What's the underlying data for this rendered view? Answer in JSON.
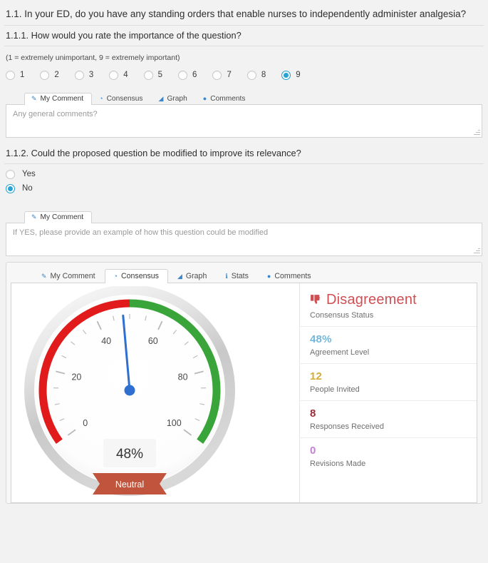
{
  "question": {
    "number": "1.1.",
    "text": "1.1. In your ED, do you have any standing orders that enable nurses to independently administer analgesia?"
  },
  "sub1": {
    "text": "1.1.1. How would you rate the importance of the question?",
    "hint": "(1 = extremely unimportant, 9 = extremely important)",
    "options": [
      "1",
      "2",
      "3",
      "4",
      "5",
      "6",
      "7",
      "8",
      "9"
    ],
    "selected": "9"
  },
  "sub2": {
    "text": "1.1.2. Could the proposed question be modified to improve its relevance?",
    "options": [
      "Yes",
      "No"
    ],
    "selected": "No"
  },
  "tabs_top": [
    {
      "label": "My Comment",
      "icon": "pencil-icon",
      "glyph": "✎",
      "active": true
    },
    {
      "label": "Consensus",
      "icon": "gauge-icon",
      "glyph": "◔",
      "active": false
    },
    {
      "label": "Graph",
      "icon": "bar-chart-icon",
      "glyph": "◢",
      "active": false
    },
    {
      "label": "Comments",
      "icon": "comment-icon",
      "glyph": "●",
      "active": false
    }
  ],
  "tabs_mid": [
    {
      "label": "My Comment",
      "icon": "pencil-icon",
      "glyph": "✎",
      "active": true
    }
  ],
  "tabs_bottom": [
    {
      "label": "My Comment",
      "icon": "pencil-icon",
      "glyph": "✎",
      "active": false
    },
    {
      "label": "Consensus",
      "icon": "gauge-icon",
      "glyph": "◔",
      "active": true
    },
    {
      "label": "Graph",
      "icon": "bar-chart-icon",
      "glyph": "◢",
      "active": false
    },
    {
      "label": "Stats",
      "icon": "info-icon",
      "glyph": "ℹ",
      "active": false
    },
    {
      "label": "Comments",
      "icon": "comment-icon",
      "glyph": "●",
      "active": false
    }
  ],
  "comment_top": {
    "placeholder": "Any general comments?",
    "value": ""
  },
  "comment_mid": {
    "placeholder": "If YES, please provide an example of how this question could be modified",
    "value": ""
  },
  "stats": [
    {
      "name": "consensus-status",
      "value": "Disagreement",
      "label": "Consensus Status",
      "color": "#cf4f55",
      "icon": "thumbs-down-icon"
    },
    {
      "name": "agreement-level",
      "value": "48%",
      "label": "Agreement Level",
      "color": "#74b7d8"
    },
    {
      "name": "people-invited",
      "value": "12",
      "label": "People Invited",
      "color": "#d3ac3c"
    },
    {
      "name": "responses-received",
      "value": "8",
      "label": "Responses Received",
      "color": "#9e2b36"
    },
    {
      "name": "revisions-made",
      "value": "0",
      "label": "Revisions Made",
      "color": "#c77fd6"
    }
  ],
  "chart_data": {
    "type": "gauge",
    "title": "Consensus Gauge",
    "value": 48,
    "value_label": "48%",
    "min": 0,
    "max": 100,
    "tick_labels": [
      "0",
      "20",
      "40",
      "60",
      "80",
      "100"
    ],
    "major_tick_values": [
      0,
      20,
      40,
      60,
      80,
      100
    ],
    "minor_tick_step": 5,
    "bands": [
      {
        "name": "disagreement",
        "from": 0,
        "to": 50,
        "color": "#e11b1b"
      },
      {
        "name": "agreement",
        "from": 50,
        "to": 100,
        "color": "#39a439"
      }
    ],
    "needle_color": "#2f6fd0",
    "badge": {
      "text": "Neutral",
      "color": "#c0543c"
    },
    "start_angle": -126,
    "end_angle": 126
  }
}
